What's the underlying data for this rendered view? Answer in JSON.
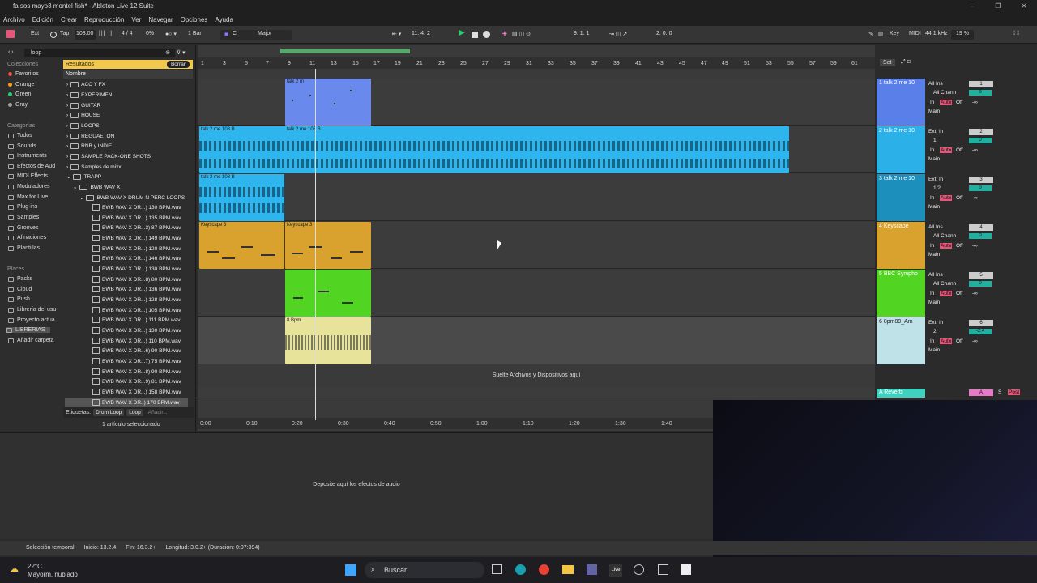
{
  "titlebar": {
    "title": "fa sos mayo3 montel fish* - Ableton Live 12 Suite",
    "min": "–",
    "max": "❐",
    "close": "✕"
  },
  "menu": [
    "Archivo",
    "Edición",
    "Crear",
    "Reproducción",
    "Ver",
    "Navegar",
    "Opciones",
    "Ayuda"
  ],
  "control": {
    "ext": "Ext",
    "tap": "Tap",
    "tempo": "103.00",
    "sig": "4 / 4",
    "pct": "0%",
    "quant": "1 Bar",
    "key": "C",
    "scale": "Major",
    "position": "11. 4. 2",
    "loop_start": "9. 1. 1",
    "loop_len": "2. 0. 0",
    "key_btn": "Key",
    "midi": "MIDI",
    "sample_rate": "44.1 kHz",
    "cpu": "19 %"
  },
  "browser": {
    "search": "loop",
    "results": "Resultados",
    "borrar": "Borrar",
    "nombre": "Nombre",
    "colecciones_hdr": "Colecciones",
    "colecciones": [
      {
        "label": "Favoritos",
        "color": "#e74c3c"
      },
      {
        "label": "Orange",
        "color": "#f39c12"
      },
      {
        "label": "Green",
        "color": "#2ecc71"
      },
      {
        "label": "Gray",
        "color": "#9e9e9e"
      }
    ],
    "categorias_hdr": "Categorías",
    "categorias": [
      "Todos",
      "Sounds",
      "Instruments",
      "Efectos de Aud",
      "MIDI Effects",
      "Moduladores",
      "Max for Live",
      "Plug-ins",
      "Samples",
      "Grooves",
      "Afinaciones",
      "Plantillas"
    ],
    "places_hdr": "Places",
    "places": [
      "Packs",
      "Cloud",
      "Push",
      "Librería del usu",
      "Proyecto actua",
      "LIBRERIAS",
      "Añadir carpeta"
    ],
    "folders": [
      "ACC Y FX",
      "EXPERIMEN",
      "GUITAR",
      "HOUSE",
      "LOOPS",
      "REGUAETON",
      "RNB y INDIE",
      "SAMPLE PACK-ONE SHOTS",
      "Samples de mixx",
      "TRAPP",
      "BWB WAV X",
      "BWB WAV X DRUM N PERC LOOPS"
    ],
    "files": [
      "BWB WAV X DR...) 130 BPM.wav",
      "BWB WAV X DR...) 135 BPM.wav",
      "BWB WAV X DR...3) 87 BPM.wav",
      "BWB WAV X DR...) 149 BPM.wav",
      "BWB WAV X DR...) 120 BPM.wav",
      "BWB WAV X DR...) 146 BPM.wav",
      "BWB WAV X DR...) 130 BPM.wav",
      "BWB WAV X DR...8) 80 BPM.wav",
      "BWB WAV X DR...) 136 BPM.wav",
      "BWB WAV X DR...) 128 BPM.wav",
      "BWB WAV X DR...) 105 BPM.wav",
      "BWB WAV X DR...) 111 BPM.wav",
      "BWB WAV X DR...) 130 BPM.wav",
      "BWB WAV X DR...) 110 BPM.wav",
      "BWB WAV X DR...6) 90 BPM.wav",
      "BWB WAV X DR...7) 75 BPM.wav",
      "BWB WAV X DR...8) 90 BPM.wav",
      "BWB WAV X DR...9) 81 BPM.wav",
      "BWB WAV X DR...) 158 BPM.wav",
      "BWB WAV X DR..) 170 BPM.wav"
    ],
    "etiquetas": "Etiquetas:",
    "tags": [
      "Drum Loop",
      "Loop",
      "Añadir..."
    ],
    "selected": "1 artículo seleccionado"
  },
  "ruler": [
    "1",
    "3",
    "5",
    "7",
    "9",
    "11",
    "13",
    "15",
    "17",
    "19",
    "21",
    "23",
    "25",
    "27",
    "29",
    "31",
    "33",
    "35",
    "37",
    "39",
    "41",
    "43",
    "45",
    "47",
    "49",
    "51",
    "53",
    "55",
    "57",
    "59",
    "61"
  ],
  "time_ruler": [
    "0:00",
    "0:10",
    "0:20",
    "0:30",
    "0:40",
    "0:50",
    "1:00",
    "1:10",
    "1:20",
    "1:30",
    "1:40"
  ],
  "set_btn": "Set",
  "clips": {
    "c1": "talk 2 m",
    "c2": "talk 2 me 103 B",
    "c3": "talk 2 me 103 B",
    "c4": "talk 2 me 103 B",
    "c5": "Keyscape 3",
    "c6": "Keyscape 3",
    "c7": "8 Bpm"
  },
  "tracks": [
    {
      "name": "1 talk 2 me 10",
      "color": "#5b7fe8",
      "input": "All Ins",
      "channel": "All Chann",
      "vol": "0",
      "num": "1",
      "in": "In",
      "auto": "Auto",
      "off": "Off",
      "out": "Main",
      "inf": "-∞"
    },
    {
      "name": "2 talk 2 me 10",
      "color": "#2bb0e8",
      "input": "Ext. In",
      "channel": "1",
      "vol": "0",
      "num": "2",
      "in": "In",
      "auto": "Auto",
      "off": "Off",
      "out": "Main",
      "inf": "-∞"
    },
    {
      "name": "3 talk 2 me 10",
      "color": "#1c8fbd",
      "input": "Ext. In",
      "channel": "1/2",
      "vol": "0",
      "num": "3",
      "in": "In",
      "auto": "Auto",
      "off": "Off",
      "out": "Main",
      "inf": "-∞"
    },
    {
      "name": "4 Keyscape",
      "color": "#d9a22e",
      "input": "All Ins",
      "channel": "All Chann",
      "vol": "0",
      "num": "4",
      "in": "In",
      "auto": "Auto",
      "off": "Off",
      "out": "Main",
      "inf": "-∞"
    },
    {
      "name": "5 BBC Sympho",
      "color": "#52d423",
      "input": "All Ins",
      "channel": "All Chann",
      "vol": "0",
      "num": "5",
      "in": "In",
      "auto": "Auto",
      "off": "Off",
      "out": "Main",
      "inf": "-∞"
    },
    {
      "name": "6 8pm89_Am",
      "color": "#bfe1e8",
      "input": "Ext. In",
      "channel": "2",
      "vol": "-2.4",
      "num": "6",
      "in": "In",
      "auto": "Auto",
      "off": "Off",
      "out": "Main",
      "inf": "-∞"
    }
  ],
  "return_track": {
    "name": "A Reverb",
    "btn": "A",
    "s": "S",
    "post": "Post"
  },
  "drop_files": "Suelte Archivos y Dispositivos aquí",
  "drop_fx": "Deposite aquí los efectos de audio",
  "status": {
    "sel": "Selección temporal",
    "start": "Inicio: 13.2.4",
    "end": "Fin: 16.3.2+",
    "len": "Longitud: 3.0.2+ (Duración: 0:07:394)"
  },
  "taskbar": {
    "temp": "22°C",
    "weather": "Mayorm. nublado",
    "search": "Buscar"
  }
}
